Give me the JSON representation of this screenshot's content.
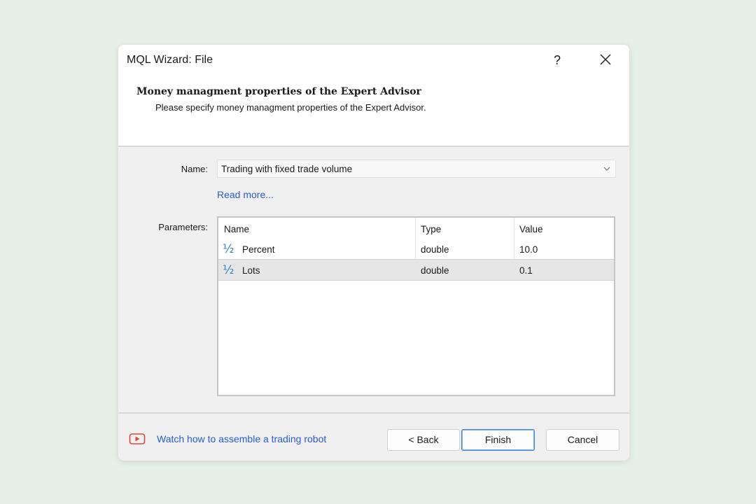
{
  "window": {
    "title": "MQL Wizard: File",
    "help_label": "?",
    "close_icon": "close-icon"
  },
  "header": {
    "title": "Money managment properties of the Expert Advisor",
    "subtitle": "Please specify money managment properties of the Expert Advisor."
  },
  "form": {
    "name_label": "Name:",
    "name_value": "Trading with fixed trade volume",
    "read_more": "Read more...",
    "parameters_label": "Parameters:"
  },
  "table": {
    "columns": [
      "Name",
      "Type",
      "Value"
    ],
    "rows": [
      {
        "icon": "fraction-icon",
        "icon_text": "½",
        "name": "Percent",
        "type": "double",
        "value": "10.0",
        "selected": false
      },
      {
        "icon": "fraction-icon",
        "icon_text": "½",
        "name": "Lots",
        "type": "double",
        "value": "0.1",
        "selected": true
      }
    ]
  },
  "footer": {
    "watch_link": "Watch how to assemble a trading robot",
    "video_icon": "video-play-icon",
    "back_label": "< Back",
    "finish_label": "Finish",
    "cancel_label": "Cancel"
  },
  "colors": {
    "link": "#2a5bd7",
    "accent_border": "#3d87d9",
    "fraction_icon": "#2f7fd0",
    "video_icon": "#e0453a"
  }
}
